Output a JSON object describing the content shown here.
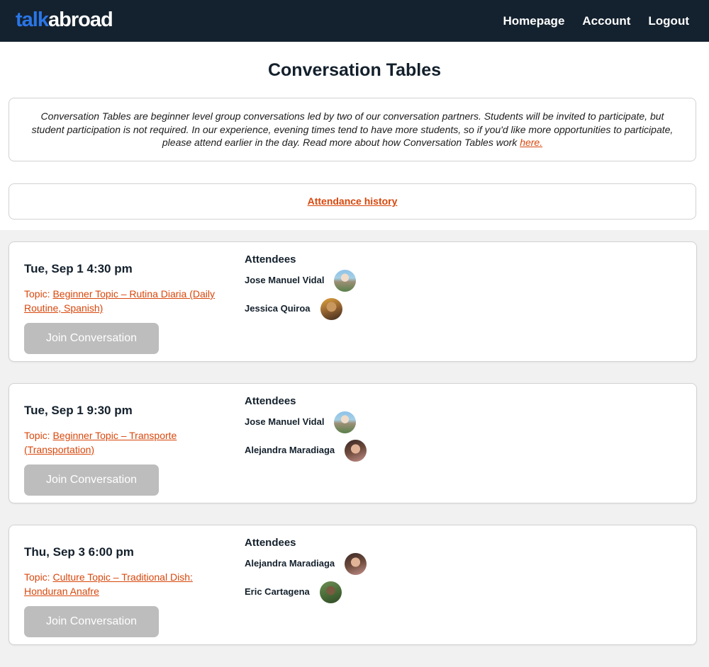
{
  "header": {
    "logo_part1": "talk",
    "logo_part2": "abroad",
    "nav": [
      "Homepage",
      "Account",
      "Logout"
    ]
  },
  "page_title": "Conversation Tables",
  "intro": {
    "text": "Conversation Tables are beginner level group conversations led by two of our conversation partners. Students will be invited to participate, but student participation is not required. In our experience, evening times tend to have more students, so if you'd like more opportunities to participate, please attend earlier in the day. Read more about how Conversation Tables work ",
    "link": "here."
  },
  "attendance_history": "Attendance history",
  "cards": [
    {
      "date": "Tue, Sep 1 4:30 pm",
      "topic_label": "Topic:",
      "topic": "Beginner Topic – Rutina Diaria (Daily Routine, Spanish)",
      "button": "Join Conversation",
      "attendees_label": "Attendees",
      "attendees": [
        "Jose Manuel Vidal",
        "Jessica Quiroa"
      ]
    },
    {
      "date": "Tue, Sep 1 9:30 pm",
      "topic_label": "Topic:",
      "topic": "Beginner Topic – Transporte (Transportation)",
      "button": "Join Conversation",
      "attendees_label": "Attendees",
      "attendees": [
        "Jose Manuel Vidal",
        "Alejandra Maradiaga"
      ]
    },
    {
      "date": "Thu, Sep 3 6:00 pm",
      "topic_label": "Topic:",
      "topic": "Culture Topic – Traditional Dish: Honduran Anafre",
      "button": "Join Conversation",
      "attendees_label": "Attendees",
      "attendees": [
        "Alejandra Maradiaga",
        "Eric Cartagena"
      ]
    }
  ],
  "colors": {
    "header_bg": "#14222f",
    "logo_accent": "#2a76e8",
    "link": "#d8470c",
    "button_disabled": "#bdbdbd"
  }
}
